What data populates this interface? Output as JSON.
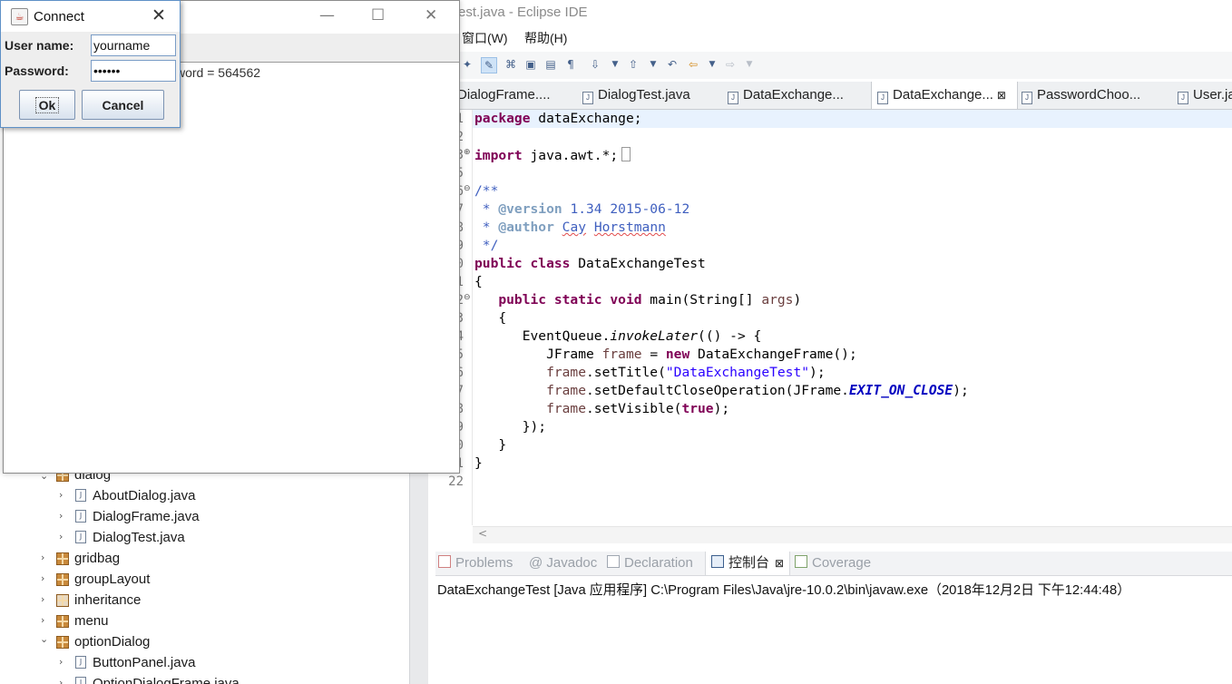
{
  "eclipse": {
    "title_fragment": "est.java - Eclipse IDE",
    "menu": [
      "窗口(W)",
      "帮助(H)"
    ],
    "editor_tabs": [
      "DialogFrame....",
      "DialogTest.java",
      "DataExchange...",
      "DataExchange...",
      "PasswordChoo...",
      "User.ja"
    ],
    "active_tab_close": "⊠",
    "code": {
      "line_numbers": [
        "1",
        "2",
        "3",
        "5",
        "6",
        "7",
        "8",
        "9",
        "0",
        "1",
        "2",
        "3",
        "4",
        "5",
        "6",
        "7",
        "8",
        "9",
        "0",
        "1",
        "22"
      ],
      "package_kw": "package",
      "package_name": " dataExchange;",
      "import_kw": "import",
      "import_rest": " java.awt.*;",
      "doc_open": "/**",
      "doc_version_tag": "@version",
      "doc_version_val": " 1.34 2015-06-12",
      "doc_author_tag": "@author",
      "doc_author_name1": "Cay",
      "doc_author_name2": "Horstmann",
      "doc_close": " */",
      "l10_kw": "public class",
      "l10_rest": " DataExchangeTest",
      "brace_open": "{",
      "l12_kw": "public static void",
      "l12_rest": " main(String[] ",
      "l12_args": "args",
      "l12_end": ")",
      "l13": "   {",
      "l14_a": "      EventQueue.",
      "l14_b": "invokeLater",
      "l14_c": "(() -> {",
      "l15_a": "         JFrame ",
      "l15_b": "frame",
      "l15_c": " = ",
      "l15_kw": "new",
      "l15_d": " DataExchangeFrame();",
      "frame_var": "frame",
      "l16_a": ".setTitle(",
      "l16_str": "\"DataExchangeTest\"",
      "l16_b": ");",
      "l17_a": ".setDefaultCloseOperation(JFrame.",
      "l17_const": "EXIT_ON_CLOSE",
      "l17_b": ");",
      "l18_a": ".setVisible(",
      "l18_kw": "true",
      "l18_b": ");",
      "l19": "      });",
      "l20": "   }",
      "l21": "}"
    },
    "console_tabs": [
      "Problems",
      "@ Javadoc",
      "Declaration",
      "控制台",
      "Coverage"
    ],
    "console_close": "⊠",
    "console_line": "DataExchangeTest [Java 应用程序] C:\\Program Files\\Java\\jre-10.0.2\\bin\\javaw.exe（2018年12月2日 下午12:44:48）",
    "tree": [
      "dialog",
      "AboutDialog.java",
      "DialogFrame.java",
      "DialogTest.java",
      "gridbag",
      "groupLayout",
      "inheritance",
      "menu",
      "optionDialog",
      "ButtonPanel.java",
      "OptionDialogFrame.java"
    ]
  },
  "frame": {
    "content_text": "word = 564562",
    "minimize": "—",
    "maximize": "☐",
    "close": "✕"
  },
  "dialog": {
    "title": "Connect",
    "close": "✕",
    "username_label": "User name:",
    "username_value": "yourname",
    "password_label": "Password:",
    "password_value": "••••••",
    "ok_label": "Ok",
    "cancel_label": "Cancel"
  }
}
